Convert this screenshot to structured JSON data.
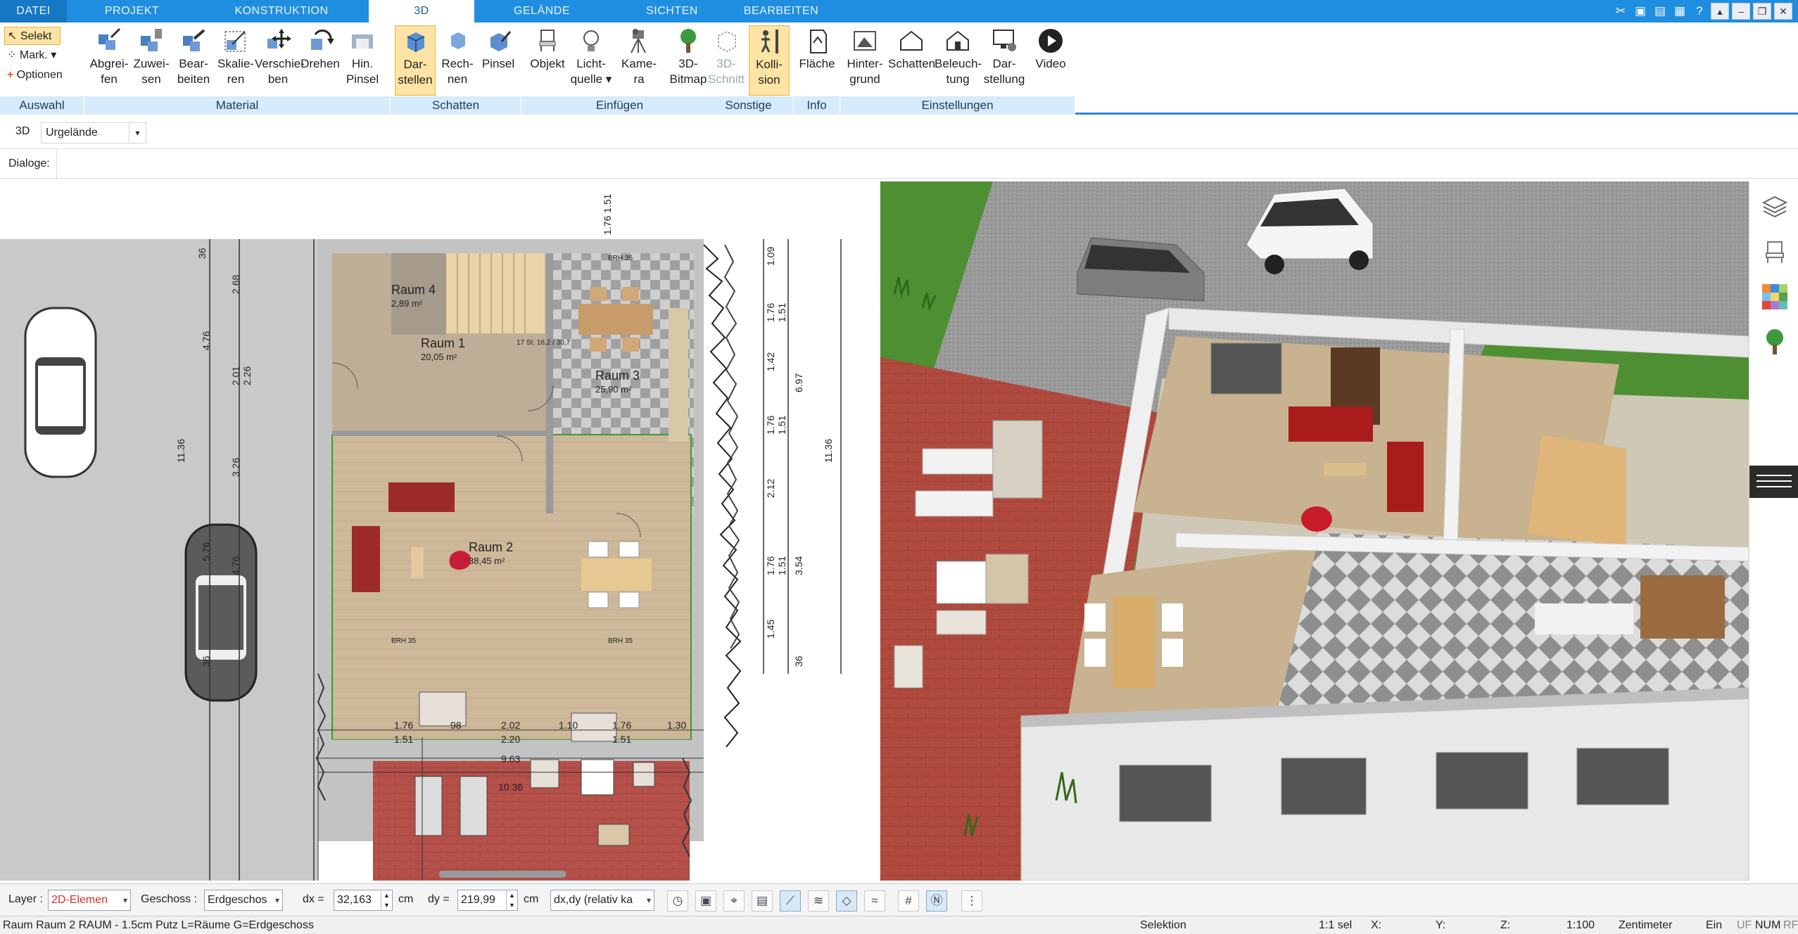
{
  "tabs": {
    "datei": "DATEI",
    "projekt": "PROJEKT",
    "konstruktion": "KONSTRUKTION",
    "d3": "3D",
    "gelaende": "GELÄNDE",
    "sichten": "SICHTEN",
    "bearbeiten": "BEARBEITEN"
  },
  "auswahl": {
    "selekt": "Selekt",
    "mark": "Mark.",
    "optionen": "Optionen",
    "title": "Auswahl"
  },
  "material": {
    "title": "Material",
    "b1": [
      "Abgrei-",
      "fen"
    ],
    "b2": [
      "Zuwei-",
      "sen"
    ],
    "b3": [
      "Bear-",
      "beiten"
    ],
    "b4": [
      "Skalie-",
      "ren"
    ],
    "b5": [
      "Verschie-",
      "ben"
    ],
    "b6": [
      "Drehen",
      ""
    ],
    "b7": [
      "Hin.",
      "Pinsel"
    ]
  },
  "schatten": {
    "title": "Schatten",
    "b1": [
      "Dar-",
      "stellen"
    ],
    "b2": [
      "Rech-",
      "nen"
    ],
    "b3": [
      "Pinsel",
      ""
    ]
  },
  "einfuegen": {
    "title": "Einfügen",
    "b1": [
      "Objekt",
      ""
    ],
    "b2": [
      "Licht-",
      "quelle ▾"
    ],
    "b3": [
      "Kame-",
      "ra"
    ],
    "b4": [
      "3D-",
      "Bitmap"
    ]
  },
  "sonstige": {
    "title": "Sonstige",
    "b1": [
      "3D-",
      "Schnitt"
    ],
    "b2": [
      "Kolli-",
      "sion"
    ]
  },
  "info": {
    "title": "Info",
    "b1": [
      "Fläche",
      ""
    ]
  },
  "einstellungen": {
    "title": "Einstellungen",
    "b1": [
      "Hinter-",
      "grund"
    ],
    "b2": [
      "Schatten",
      ""
    ],
    "b3": [
      "Beleuch-",
      "tung"
    ],
    "b4": [
      "Dar-",
      "stellung"
    ],
    "b5": [
      "Video",
      ""
    ]
  },
  "row3d": {
    "label": "3D",
    "select": "Urgelände"
  },
  "dialoge": "Dialoge:",
  "plan": {
    "rooms": [
      {
        "name": "Raum 4",
        "area": "2,89 m²"
      },
      {
        "name": "Raum 1",
        "area": "20,05 m²"
      },
      {
        "name": "Raum 3",
        "area": "25,90 m²"
      },
      {
        "name": "Raum 2",
        "area": "38,45 m²"
      }
    ],
    "dims_left": [
      "36",
      "2.68",
      "4.76",
      "2.01",
      "2.26",
      "3.26",
      "4.76",
      "5.76",
      "36"
    ],
    "dims_right": [
      "1.09",
      "1.76",
      "1.51",
      "1.42",
      "6.97",
      "1.76",
      "1.51",
      "2.12",
      "1.76",
      "1.51",
      "3.54",
      "1.45",
      "36"
    ],
    "dims_bottom": [
      "1.76",
      "1.51",
      "98",
      "2.02",
      "2.20",
      "1.10",
      "1.76",
      "1.51",
      "1.30",
      "9.63",
      "10.36"
    ],
    "big_left": "11.36",
    "big_right": "11.36",
    "top_dim": "1.76 1.51",
    "stairs": "17 St. 16,2 / 30,7",
    "brh": "BRH 35"
  },
  "toolbar": {
    "layer_label": "Layer :",
    "layer_value": "2D-Elemen",
    "geschoss_label": "Geschoss :",
    "geschoss_value": "Erdgeschos",
    "dx_label": "dx =",
    "dx_value": "32,163",
    "dx_unit": "cm",
    "dy_label": "dy =",
    "dy_value": "219,99",
    "dy_unit": "cm",
    "mode_value": "dx,dy (relativ ka"
  },
  "status": {
    "left": "Raum Raum 2 RAUM - 1.5cm Putz L=Räume G=Erdgeschoss",
    "selektion": "Selektion",
    "sel": "1:1 sel",
    "x": "X:",
    "y": "Y:",
    "z": "Z:",
    "scale": "1:100",
    "unit": "Zentimeter",
    "ein": "Ein",
    "uf": "UF",
    "num": "NUM",
    "rf": "RF"
  },
  "colors": {
    "tabbar": "#1f8ee0",
    "group_bg": "#d6ebfb",
    "selected": "#fde3a4",
    "brick": "#b5504a",
    "grass": "#3f8a2a"
  },
  "side_icons": [
    "layers-icon",
    "chair-icon",
    "material-palette-icon",
    "tree-icon"
  ]
}
